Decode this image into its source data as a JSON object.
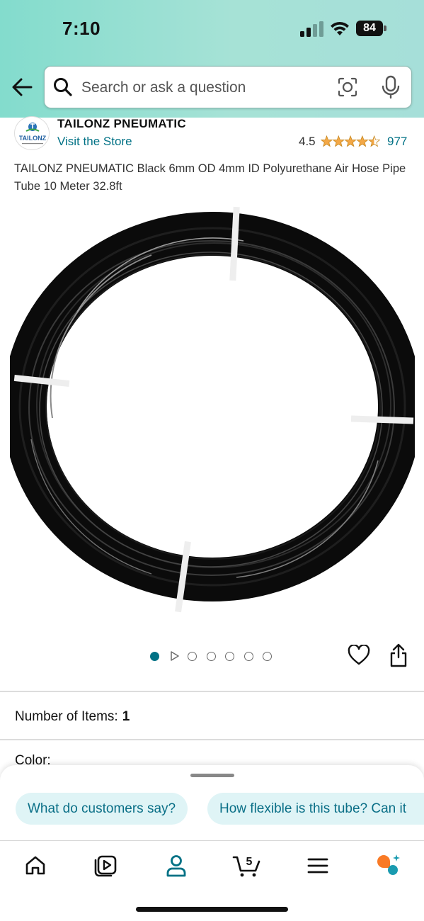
{
  "status_bar": {
    "time": "7:10",
    "battery": "84"
  },
  "search": {
    "placeholder": "Search or ask a question"
  },
  "store": {
    "name": "TAILONZ PNEUMATIC",
    "visit_label": "Visit the Store",
    "logo_text": "TAILONZ"
  },
  "rating": {
    "value": "4.5",
    "stars": 4.5,
    "count": "977"
  },
  "product": {
    "title": "TAILONZ PNEUMATIC Black 6mm OD 4mm ID Polyurethane Air Hose Pipe Tube 10 Meter 32.8ft",
    "image": "black-air-hose-coil"
  },
  "gallery": {
    "total_items": 7,
    "active_index": 0,
    "video_index": 1
  },
  "options": {
    "number_of_items_label": "Number of Items:",
    "number_of_items_value": "1",
    "color_label": "Color:"
  },
  "suggestions": [
    "What do customers say?",
    "How flexible is this tube? Can it"
  ],
  "tabs": [
    "home-icon",
    "video-icon",
    "account-icon",
    "cart-icon",
    "menu-icon",
    "rufus-icon"
  ],
  "cart_count": "5",
  "colors": {
    "accent": "#007185",
    "chip_bg": "#dff4f6",
    "header": "#a6e2d6",
    "star": "#f3a847"
  }
}
